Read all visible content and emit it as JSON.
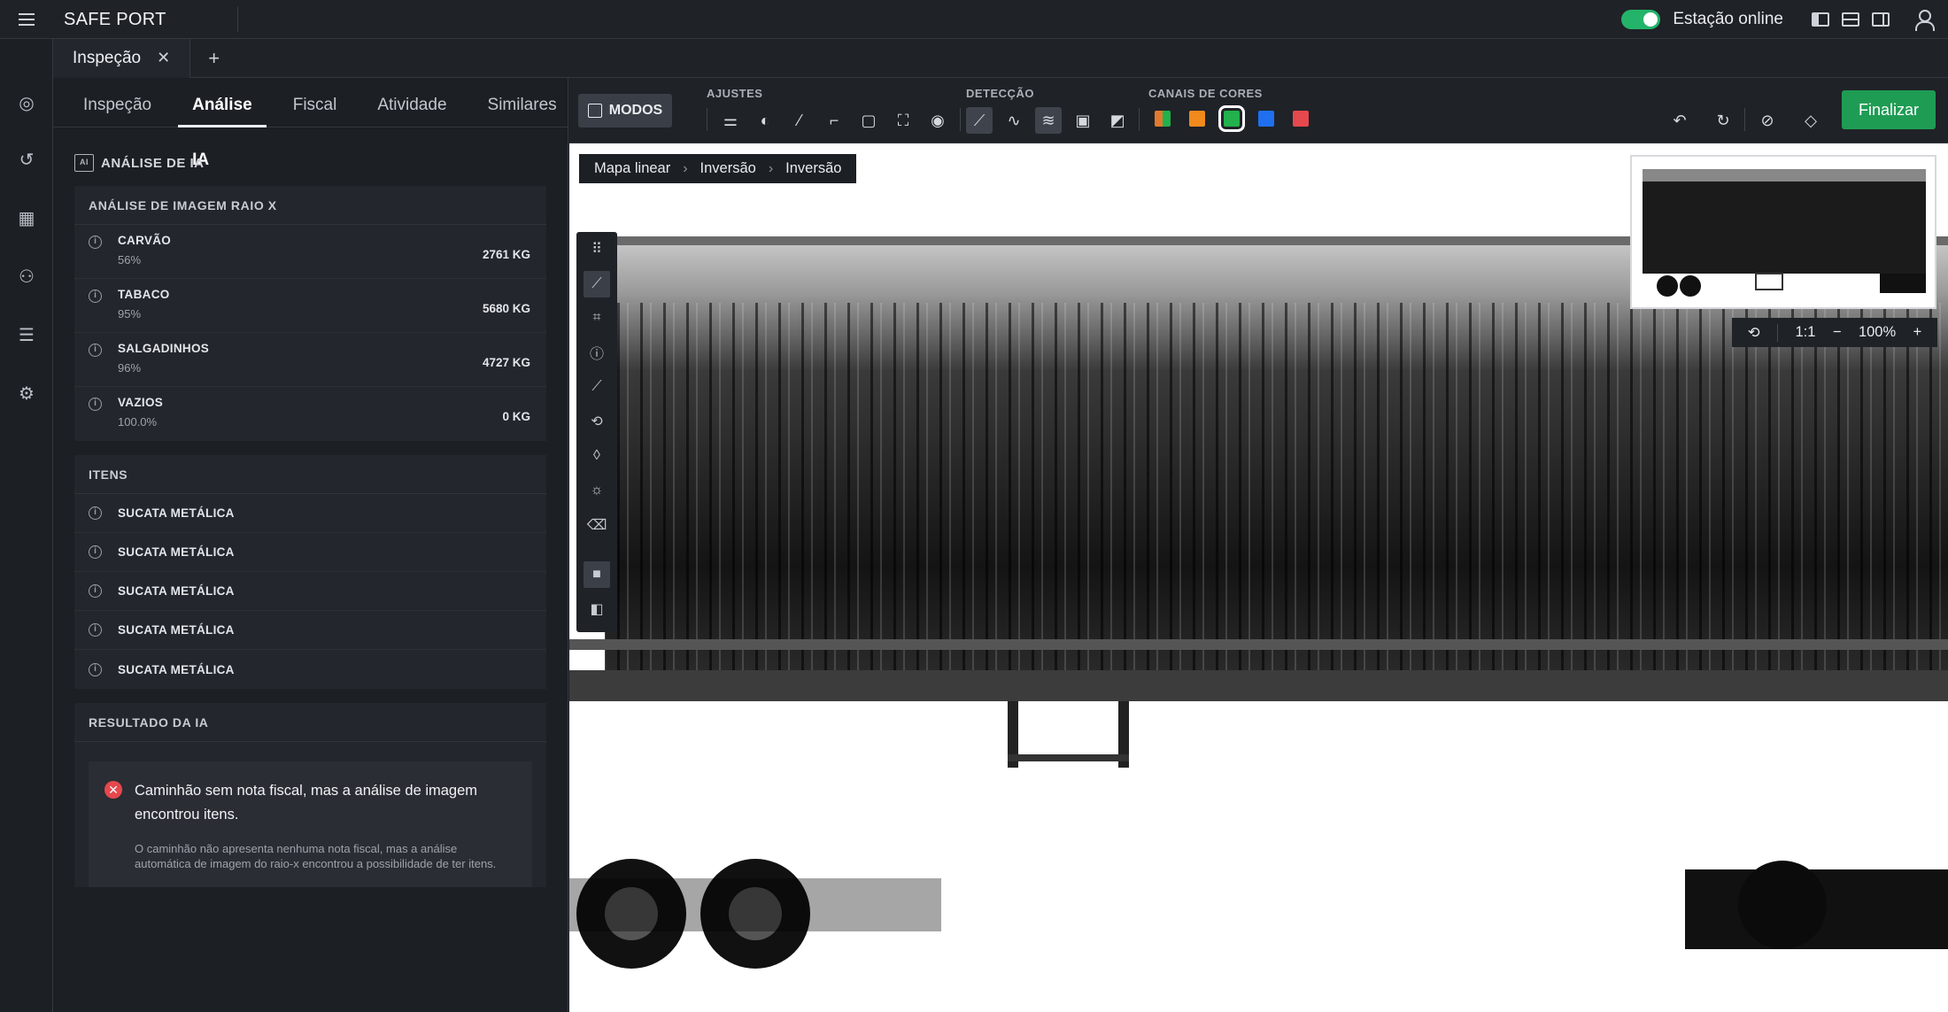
{
  "app": {
    "title": "SAFE PORT",
    "station_status": "Estação online"
  },
  "tabs": [
    {
      "label": "Inspeção"
    }
  ],
  "panel": {
    "subtabs": [
      "Inspeção",
      "Análise IA",
      "Fiscal",
      "Atividade",
      "Similares"
    ],
    "active_subtab": "Análise IA",
    "section_title": "ANÁLISE DE IA",
    "ai_icon_text": "AI",
    "xray": {
      "header": "ANÁLISE DE IMAGEM RAIO X",
      "rows": [
        {
          "name": "CARVÃO",
          "pct": "56%",
          "value": "2761 KG"
        },
        {
          "name": "TABACO",
          "pct": "95%",
          "value": "5680 KG"
        },
        {
          "name": "SALGADINHOS",
          "pct": "96%",
          "value": "4727 KG"
        },
        {
          "name": "VAZIOS",
          "pct": "100.0%",
          "value": "0 KG"
        }
      ]
    },
    "items": {
      "header": "ITENS",
      "list": [
        "SUCATA METÁLICA",
        "SUCATA METÁLICA",
        "SUCATA METÁLICA",
        "SUCATA METÁLICA",
        "SUCATA METÁLICA"
      ]
    },
    "result": {
      "header": "RESULTADO DA IA",
      "title": "Caminhão sem nota fiscal, mas a análise de imagem encontrou itens.",
      "description": "O caminhão não apresenta nenhuma nota fiscal, mas a análise automática de imagem do raio-x encontrou a possibilidade de ter itens."
    }
  },
  "toolbar": {
    "modos_label": "MODOS",
    "groups": {
      "ajustes": "AJUSTES",
      "deteccao": "DETECÇÃO",
      "canais": "CANAIS DE CORES"
    },
    "swatches": [
      "#e07a2e",
      "#f08a1c",
      "#22b14c",
      "#1f6ff0",
      "#e5484d"
    ],
    "finalize_label": "Finalizar"
  },
  "viewer": {
    "breadcrumb": [
      "Mapa linear",
      "Inversão",
      "Inversão"
    ],
    "zoom": {
      "ratio": "1:1",
      "level": "100%"
    }
  },
  "colors": {
    "accent_green": "#1f9c54",
    "online_green": "#23b46a",
    "error_red": "#e5484d"
  }
}
